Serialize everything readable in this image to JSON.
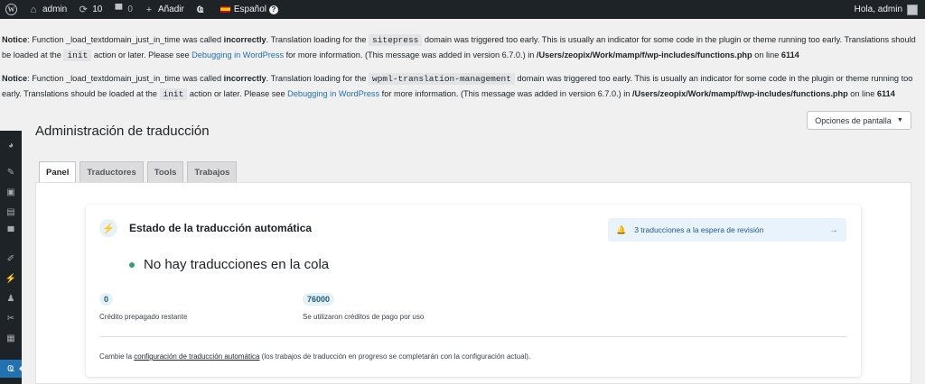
{
  "admin_bar": {
    "site_name": "admin",
    "updates_count": "10",
    "comments_count": "0",
    "new_label": "Añadir",
    "language_label": "Español",
    "greeting": "Hola, admin"
  },
  "notices": [
    {
      "prefix": "Notice",
      "text_1": ": Function _load_textdomain_just_in_time was called ",
      "emphasis": "incorrectly",
      "text_2": ". Translation loading for the ",
      "code_domain": "sitepress",
      "text_3": " domain was triggered too early. This is usually an indicator for some code in the plugin or theme running too early. Translations should be loaded at the ",
      "code_action": "init",
      "text_4": " action or later. Please see ",
      "link_text": "Debugging in WordPress",
      "text_5": " for more information. (This message was added in version 6.7.0.) in ",
      "path": "/Users/zeopix/Work/mamp/f/wp-includes/functions.php",
      "text_6": " on line ",
      "line": "6114"
    },
    {
      "prefix": "Notice",
      "text_1": ": Function _load_textdomain_just_in_time was called ",
      "emphasis": "incorrectly",
      "text_2": ". Translation loading for the ",
      "code_domain": "wpml-translation-management",
      "text_3": " domain was triggered too early. This is usually an indicator for some code in the plugin or theme running too early. Translations should be loaded at the ",
      "code_action": "init",
      "text_4": " action or later. Please see ",
      "link_text": "Debugging in WordPress",
      "text_5": " for more information. (This message was added in version 6.7.0.) in ",
      "path": "/Users/zeopix/Work/mamp/f/wp-includes/functions.php",
      "text_6": " on line ",
      "line": "6114"
    }
  ],
  "screen_options": {
    "label": "Opciones de pantalla"
  },
  "page": {
    "title": "Administración de traducción"
  },
  "tabs": [
    {
      "label": "Panel",
      "active": true
    },
    {
      "label": "Traductores",
      "active": false
    },
    {
      "label": "Tools",
      "active": false
    },
    {
      "label": "Trabajos",
      "active": false
    }
  ],
  "card": {
    "title": "Estado de la traducción automática",
    "review_text": "3 traducciones a la espera de revisión",
    "queue_status": "No hay traducciones en la cola",
    "credits_prepaid_value": "0",
    "credits_prepaid_label": "Crédito prepagado restante",
    "credits_paid_value": "76000",
    "credits_paid_label": "Se utilizaron créditos de pago por uso",
    "footer_prefix": "Cambie la ",
    "footer_link": "configuración de traducción automática",
    "footer_suffix": " (los trabajos de traducción en progreso se completarán con la configuración actual)."
  },
  "colors": {
    "admin_bar": "#1d2327",
    "accent": "#2271b1",
    "status_ok": "#2ea36f"
  }
}
